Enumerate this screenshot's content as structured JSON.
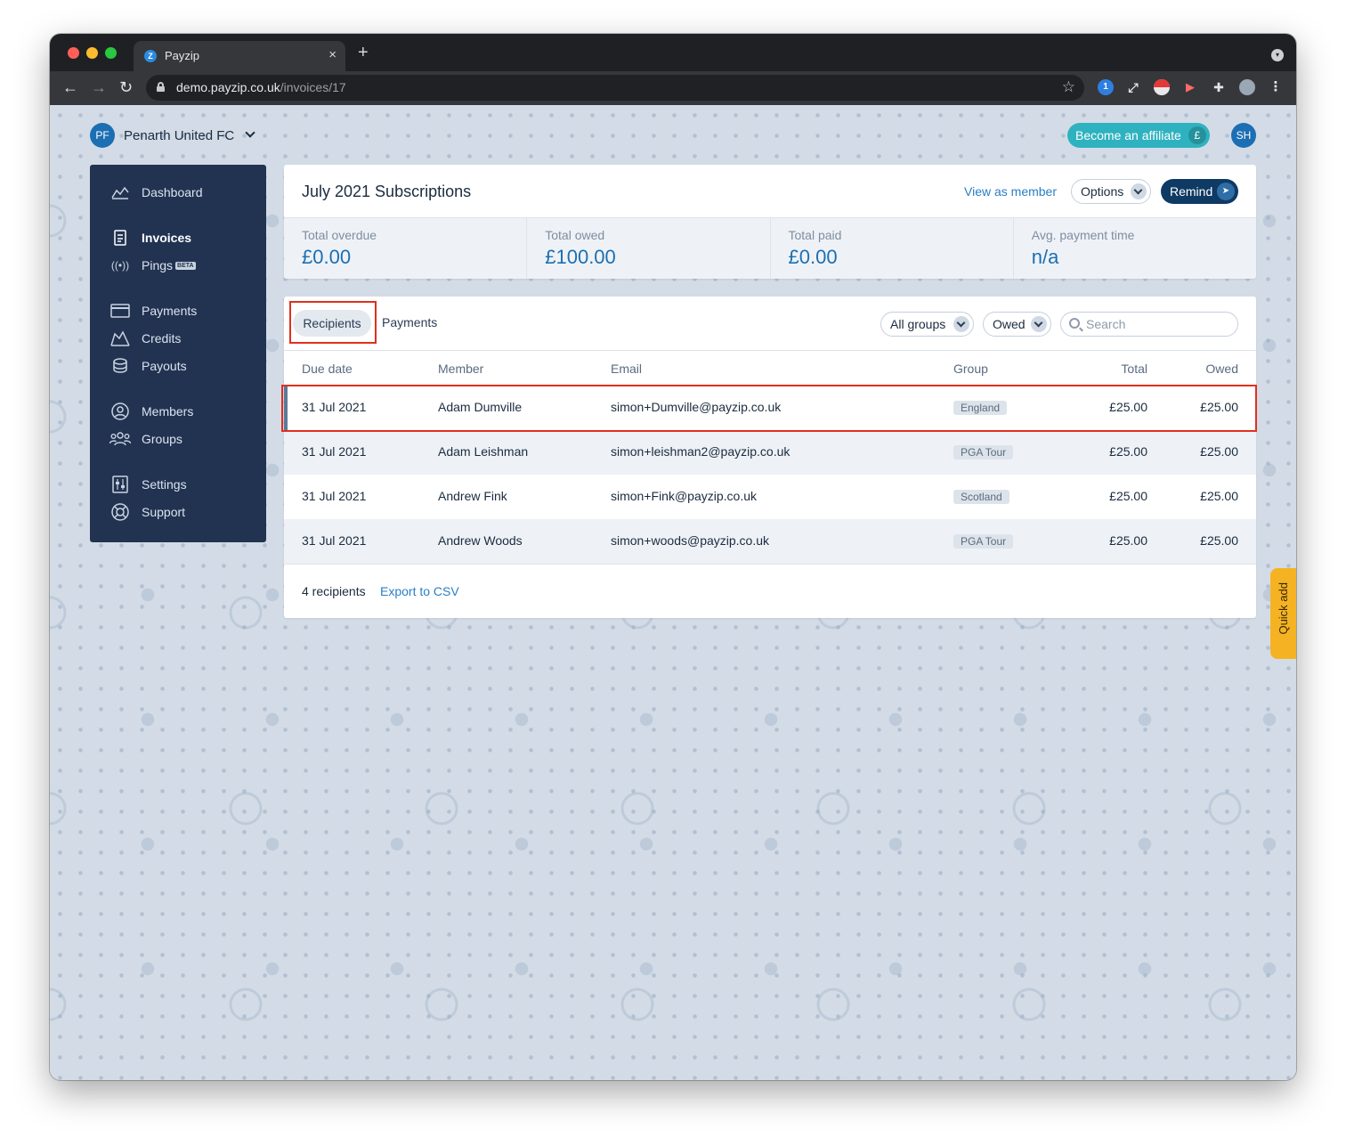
{
  "browser": {
    "tab_title": "Payzip",
    "url_host": "demo.payzip.co.uk",
    "url_path": "/invoices/17",
    "new_tab_label": "+",
    "close_label": "×"
  },
  "org": {
    "initials": "PF",
    "name": "Penarth United FC"
  },
  "header": {
    "affiliate_label": "Become an affiliate",
    "affiliate_icon": "£",
    "user_initials": "SH"
  },
  "sidebar": {
    "items": [
      {
        "label": "Dashboard",
        "icon": "chart-icon"
      },
      {
        "label": "Invoices",
        "icon": "invoice-icon",
        "active": true
      },
      {
        "label": "Pings",
        "icon": "broadcast-icon",
        "badge": "BETA"
      },
      {
        "label": "Payments",
        "icon": "card-icon"
      },
      {
        "label": "Credits",
        "icon": "credits-icon"
      },
      {
        "label": "Payouts",
        "icon": "coins-icon"
      },
      {
        "label": "Members",
        "icon": "user-icon"
      },
      {
        "label": "Groups",
        "icon": "groups-icon"
      },
      {
        "label": "Settings",
        "icon": "settings-icon"
      },
      {
        "label": "Support",
        "icon": "lifebuoy-icon"
      }
    ]
  },
  "invoice": {
    "title": "July 2021 Subscriptions",
    "view_as_member": "View as member",
    "options_label": "Options",
    "remind_label": "Remind",
    "stats": [
      {
        "label": "Total overdue",
        "value": "£0.00"
      },
      {
        "label": "Total owed",
        "value": "£100.00"
      },
      {
        "label": "Total paid",
        "value": "£0.00"
      },
      {
        "label": "Avg. payment time",
        "value": "n/a"
      }
    ]
  },
  "list": {
    "tabs": [
      "Recipients",
      "Payments"
    ],
    "filters": {
      "group": "All groups",
      "status": "Owed"
    },
    "search_placeholder": "Search",
    "columns": [
      "Due date",
      "Member",
      "Email",
      "Group",
      "Total",
      "Owed"
    ],
    "rows": [
      {
        "due": "31 Jul 2021",
        "member": "Adam Dumville",
        "email": "simon+Dumville@payzip.co.uk",
        "group": "England",
        "total": "£25.00",
        "owed": "£25.00"
      },
      {
        "due": "31 Jul 2021",
        "member": "Adam Leishman",
        "email": "simon+leishman2@payzip.co.uk",
        "group": "PGA Tour",
        "total": "£25.00",
        "owed": "£25.00"
      },
      {
        "due": "31 Jul 2021",
        "member": "Andrew Fink",
        "email": "simon+Fink@payzip.co.uk",
        "group": "Scotland",
        "total": "£25.00",
        "owed": "£25.00"
      },
      {
        "due": "31 Jul 2021",
        "member": "Andrew Woods",
        "email": "simon+woods@payzip.co.uk",
        "group": "PGA Tour",
        "total": "£25.00",
        "owed": "£25.00"
      }
    ],
    "footer_count": "4 recipients",
    "export_label": "Export to CSV"
  },
  "quick_add_label": "Quick add",
  "colors": {
    "sidebar_bg": "#223352",
    "accent_blue": "#1c6fb3",
    "affiliate_teal": "#2fb2bf",
    "remind_navy": "#0f3a63",
    "quick_add_yellow": "#f5b323",
    "highlight_red": "#e0301e"
  }
}
